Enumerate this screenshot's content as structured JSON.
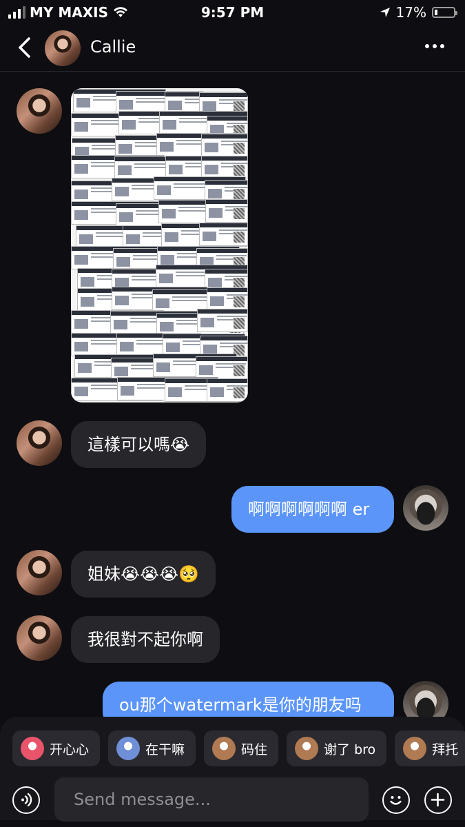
{
  "status": {
    "carrier": "MY MAXIS",
    "time": "9:57 PM",
    "battery": "17%",
    "battery_level": 0.17
  },
  "header": {
    "contact_name": "Callie"
  },
  "messages": [
    {
      "from": "Callie",
      "type": "image"
    },
    {
      "from": "Callie",
      "text": "這樣可以嗎😭"
    },
    {
      "from": "me",
      "text": "啊啊啊啊啊啊 er"
    },
    {
      "from": "Callie",
      "text": "姐妹😭😭😭🥺"
    },
    {
      "from": "Callie",
      "text": "我很對不起你啊"
    },
    {
      "from": "me",
      "text": "ou那个watermark是你的朋友吗"
    }
  ],
  "quick_replies": [
    {
      "label": "开心心",
      "icon": "happy-sticker-icon",
      "color": "#e9546b"
    },
    {
      "label": "在干嘛",
      "icon": "what-sticker-icon",
      "color": "#6f8fd8"
    },
    {
      "label": "码住",
      "icon": "monkey-sticker-icon",
      "color": "#b07a52"
    },
    {
      "label": "谢了 bro",
      "icon": "monkey-thanks-icon",
      "color": "#b07a52"
    },
    {
      "label": "拜托",
      "icon": "monkey-please-icon",
      "color": "#b07a52"
    }
  ],
  "composer": {
    "placeholder": "Send message..."
  },
  "colors": {
    "outgoing_bubble": "#5b95f9",
    "incoming_bubble": "#26262b",
    "background": "#0e0e12"
  }
}
